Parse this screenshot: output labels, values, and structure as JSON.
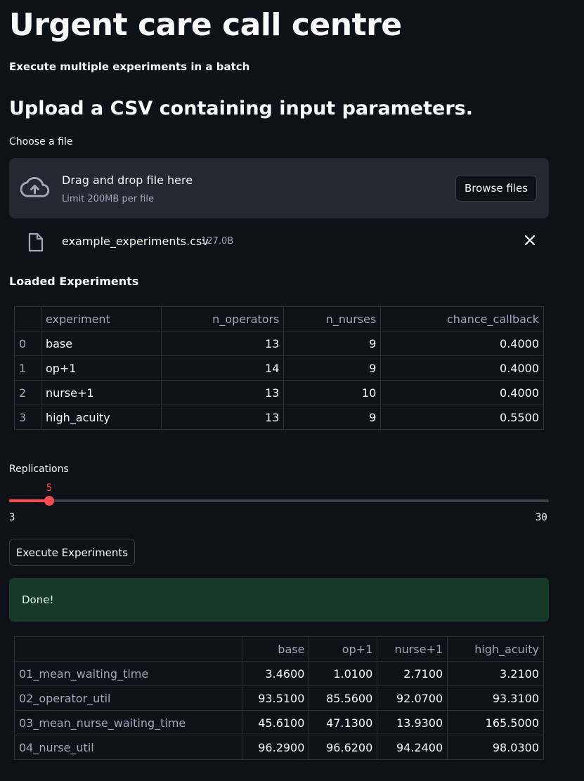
{
  "header": {
    "title": "Urgent care call centre",
    "subtitle": "Execute multiple experiments in a batch"
  },
  "upload": {
    "section_title": "Upload a CSV containing input parameters.",
    "label": "Choose a file",
    "drag_text": "Drag and drop file here",
    "limit_text": "Limit 200MB per file",
    "browse_label": "Browse files",
    "icon": "cloud-upload-icon",
    "file": {
      "name": "example_experiments.csv",
      "size": "127.0B",
      "icon": "file-icon",
      "remove_icon": "close-icon"
    }
  },
  "loaded": {
    "heading": "Loaded Experiments",
    "columns": [
      "",
      "experiment",
      "n_operators",
      "n_nurses",
      "chance_callback"
    ],
    "rows": [
      [
        "0",
        "base",
        "13",
        "9",
        "0.4000"
      ],
      [
        "1",
        "op+1",
        "14",
        "9",
        "0.4000"
      ],
      [
        "2",
        "nurse+1",
        "13",
        "10",
        "0.4000"
      ],
      [
        "3",
        "high_acuity",
        "13",
        "9",
        "0.5500"
      ]
    ]
  },
  "replications": {
    "label": "Replications",
    "value": 5,
    "value_text": "5",
    "min": 3,
    "min_text": "3",
    "max": 30,
    "max_text": "30",
    "accent_color": "#ff4b4b"
  },
  "actions": {
    "execute_label": "Execute Experiments"
  },
  "status": {
    "message": "Done!",
    "color": "#173928"
  },
  "results": {
    "columns": [
      "",
      "base",
      "op+1",
      "nurse+1",
      "high_acuity"
    ],
    "rows": [
      [
        "01_mean_waiting_time",
        "3.4600",
        "1.0100",
        "2.7100",
        "3.2100"
      ],
      [
        "02_operator_util",
        "93.5100",
        "85.5600",
        "92.0700",
        "93.3100"
      ],
      [
        "03_mean_nurse_waiting_time",
        "45.6100",
        "47.1300",
        "13.9300",
        "165.5000"
      ],
      [
        "04_nurse_util",
        "96.2900",
        "96.6200",
        "94.2400",
        "98.0300"
      ]
    ]
  }
}
